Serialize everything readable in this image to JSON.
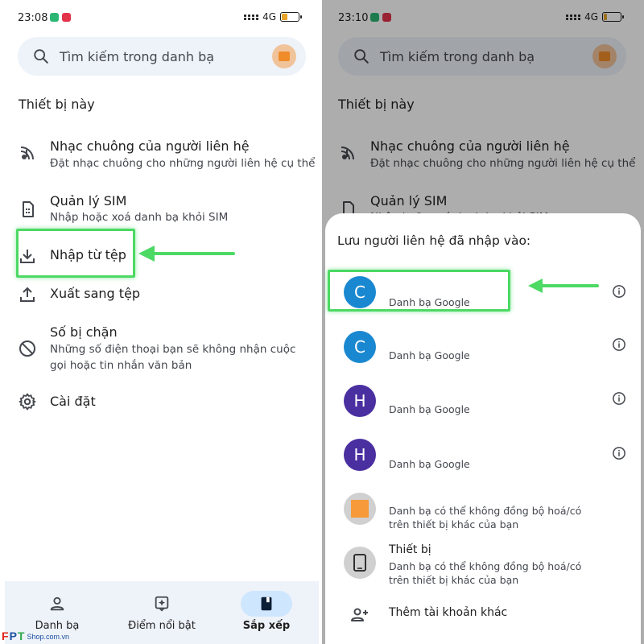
{
  "left": {
    "status": {
      "time": "23:08",
      "network": "4G"
    },
    "search_placeholder": "Tìm kiếm trong danh bạ",
    "section_title": "Thiết bị này",
    "menu": [
      {
        "label": "Nhạc chuông của người liên hệ",
        "sub": "Đặt nhạc chuông cho những người liên hệ cụ thể",
        "icon": "ringtone-icon"
      },
      {
        "label": "Quản lý SIM",
        "sub": "Nhập hoặc xoá danh bạ khỏi SIM",
        "icon": "sim-card-icon"
      },
      {
        "label": "Nhập từ tệp",
        "sub": "",
        "icon": "download-icon"
      },
      {
        "label": "Xuất sang tệp",
        "sub": "",
        "icon": "upload-icon"
      },
      {
        "label": "Số bị chặn",
        "sub": "Những số điện thoại bạn sẽ không nhận cuộc gọi hoặc tin nhắn văn bản",
        "icon": "block-icon"
      },
      {
        "label": "Cài đặt",
        "sub": "",
        "icon": "gear-icon"
      }
    ],
    "nav": [
      {
        "label": "Danh bạ",
        "icon": "person-icon"
      },
      {
        "label": "Điểm nổi bật",
        "icon": "highlights-icon"
      },
      {
        "label": "Sắp xếp",
        "icon": "organize-icon"
      }
    ]
  },
  "right": {
    "status": {
      "time": "23:10",
      "network": "4G"
    },
    "search_placeholder": "Tìm kiếm trong danh bạ",
    "section_title": "Thiết bị này",
    "menu": [
      {
        "label": "Nhạc chuông của người liên hệ",
        "sub": "Đặt nhạc chuông cho những người liên hệ cụ thể"
      },
      {
        "label": "Quản lý SIM",
        "sub": "Nhập hoặc xoá danh bạ khỏi SIM"
      }
    ],
    "sheet": {
      "title": "Lưu người liên hệ đã nhập vào:",
      "accounts": [
        {
          "initial": "C",
          "name": "",
          "sub": "Danh bạ Google",
          "color": "#1a88d0"
        },
        {
          "initial": "C",
          "name": "",
          "sub": "Danh bạ Google",
          "color": "#1a88d0"
        },
        {
          "initial": "H",
          "name": "",
          "sub": "Danh bạ Google",
          "color": "#4a2fa0"
        },
        {
          "initial": "H",
          "name": "",
          "sub": "Danh bạ Google",
          "color": "#4a2fa0"
        },
        {
          "initial": "",
          "name": "",
          "sub": "Danh bạ có thể không đồng bộ hoá/có trên thiết bị khác của bạn",
          "color": "#d0d0d0"
        },
        {
          "initial": "",
          "name": "Thiết bị",
          "sub": "Danh bạ có thể không đồng bộ hoá/có trên thiết bị khác của bạn",
          "color": "#d0d0d0"
        }
      ],
      "add_account": "Thêm tài khoản khác"
    }
  },
  "watermark": {
    "f": "F",
    "p": "P",
    "t": "T",
    "shop": "Shop.com.vn"
  },
  "colors": {
    "highlight": "#4cd964",
    "accent_blue": "#1a88d0",
    "accent_purple": "#4a2fa0",
    "nav_active": "#cfe6ff"
  }
}
